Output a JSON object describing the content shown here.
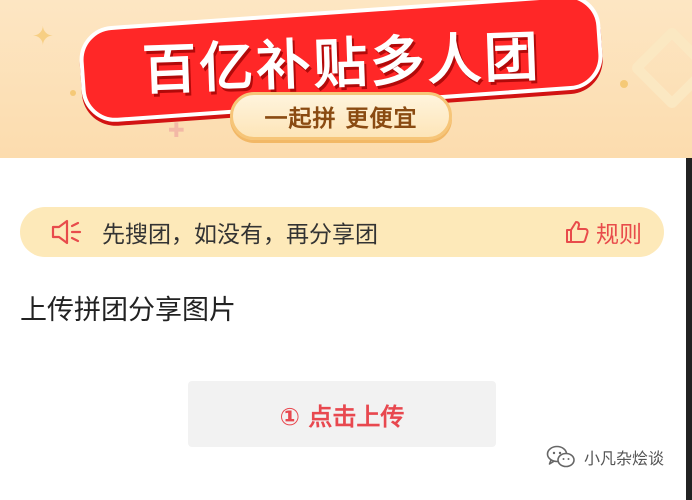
{
  "banner": {
    "title": "百亿补贴多人团",
    "subtitle": "一起拼 更便宜"
  },
  "notice": {
    "icon": "speaker-icon",
    "text": "先搜团，如没有，再分享团",
    "rules_icon": "thumb-up-icon",
    "rules_label": "规则"
  },
  "upload": {
    "section_title": "上传拼团分享图片",
    "button_label": "① 点击上传"
  },
  "watermark": {
    "icon": "wechat-icon",
    "text": "小凡杂烩谈"
  },
  "colors": {
    "accent_red": "#e8484f",
    "banner_bg": "#fde6c3",
    "notice_bg": "#fde9b9",
    "button_bg": "#f2f2f2",
    "title_red": "#ff2727"
  }
}
